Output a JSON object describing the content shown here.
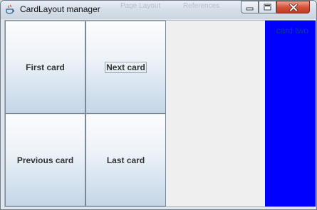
{
  "window": {
    "title": "CardLayout manager",
    "background_titles": [
      "Page Layout",
      "References"
    ]
  },
  "buttons": {
    "first_label": "First card",
    "next_label": "Next card",
    "previous_label": "Previous card",
    "last_label": "Last card"
  },
  "card": {
    "label": "card two",
    "color": "#0000ff"
  },
  "icons": {
    "app": "java-icon",
    "minimize": "minimize-icon",
    "maximize": "maximize-icon",
    "close": "close-icon"
  }
}
